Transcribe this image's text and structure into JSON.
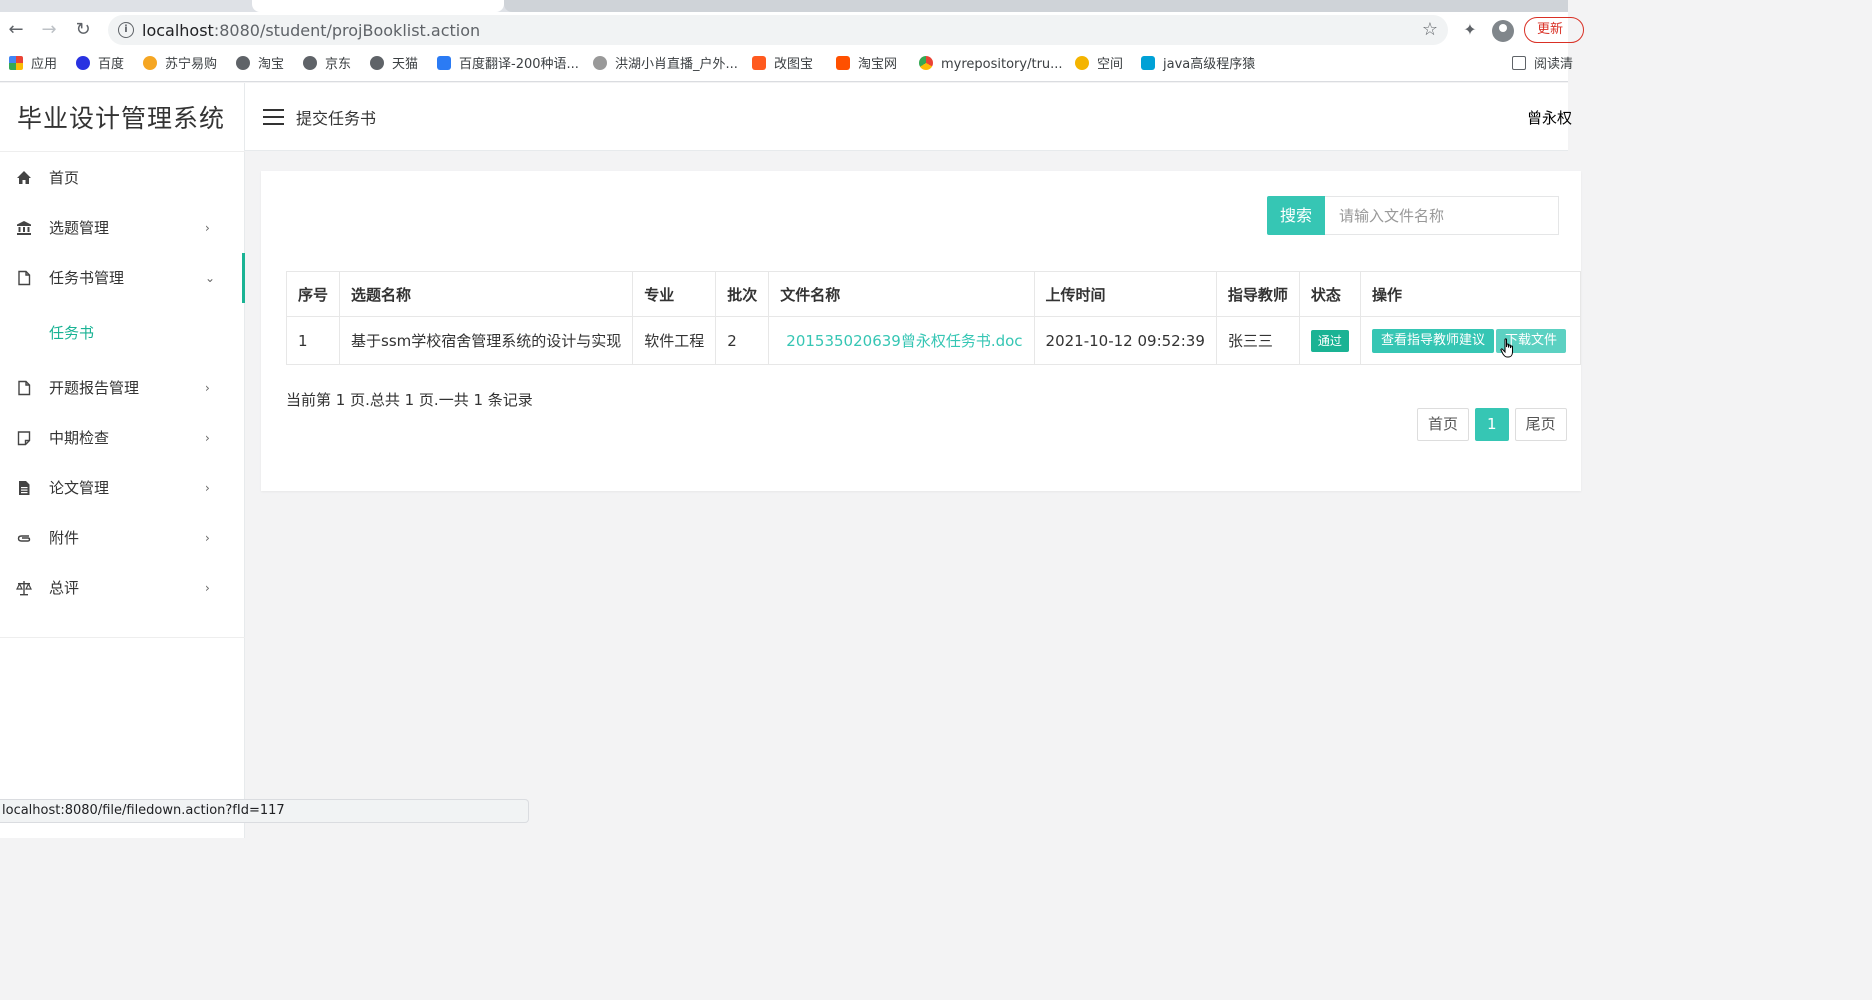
{
  "browser": {
    "url_host": "localhost",
    "url_rest": ":8080/student/projBooklist.action",
    "update_label": "更新",
    "bookmarks": [
      {
        "label": "应用",
        "icon": "apps-grid-icon",
        "color": "#4285f4"
      },
      {
        "label": "百度",
        "icon": "baidu-paw-icon",
        "color": "#2932e1"
      },
      {
        "label": "苏宁易购",
        "icon": "suning-icon",
        "color": "#f5a623"
      },
      {
        "label": "淘宝",
        "icon": "globe-icon",
        "color": "#5f6368"
      },
      {
        "label": "京东",
        "icon": "globe-icon",
        "color": "#5f6368"
      },
      {
        "label": "天猫",
        "icon": "globe-icon",
        "color": "#5f6368"
      },
      {
        "label": "百度翻译-200种语...",
        "icon": "translate-icon",
        "color": "#2b7bf4"
      },
      {
        "label": "洪湖小肖直播_户外...",
        "icon": "bird-icon",
        "color": "#888888"
      },
      {
        "label": "改图宝",
        "icon": "gaitubao-icon",
        "color": "#ff5a1f"
      },
      {
        "label": "淘宝网",
        "icon": "taobao-icon",
        "color": "#ff5000"
      },
      {
        "label": "myrepository/tru...",
        "icon": "chrome-icon",
        "color": "#34a853"
      },
      {
        "label": "空间",
        "icon": "qzone-icon",
        "color": "#f4b400"
      },
      {
        "label": "java高级程序猿",
        "icon": "bilibili-icon",
        "color": "#00a1d6"
      },
      {
        "label": "阅读清",
        "icon": "reading-list-icon",
        "color": "#5f6368"
      }
    ],
    "status_url": "localhost:8080/file/filedown.action?fId=117"
  },
  "app": {
    "logo": "毕业设计管理系统",
    "header_title": "提交任务书",
    "user_name": "曾永权",
    "menu": [
      {
        "label": "首页",
        "icon": "home-icon",
        "arrow": ""
      },
      {
        "label": "选题管理",
        "icon": "bank-icon",
        "arrow": "›"
      },
      {
        "label": "任务书管理",
        "icon": "file-icon",
        "arrow": "⌄"
      },
      {
        "label": "开题报告管理",
        "icon": "file-icon",
        "arrow": "›"
      },
      {
        "label": "中期检查",
        "icon": "note-icon",
        "arrow": "›"
      },
      {
        "label": "论文管理",
        "icon": "document-icon",
        "arrow": "›"
      },
      {
        "label": "附件",
        "icon": "paperclip-icon",
        "arrow": "›"
      },
      {
        "label": "总评",
        "icon": "balance-scale-icon",
        "arrow": "›"
      }
    ],
    "submenu_item": "任务书",
    "search": {
      "button_label": "搜索",
      "placeholder": "请输入文件名称",
      "value": ""
    },
    "table": {
      "columns": [
        "序号",
        "选题名称",
        "专业",
        "批次",
        "文件名称",
        "上传时间",
        "指导教师",
        "状态",
        "操作"
      ],
      "rows": [
        {
          "index": "1",
          "topic": "基于ssm学校宿舍管理系统的设计与实现",
          "major": "软件工程",
          "batch": "2",
          "file_name": "201535020639曾永权任务书.doc",
          "upload_time": "2021-10-12 09:52:39",
          "teacher": "张三三",
          "status": "通过",
          "actions": [
            "查看指导教师建议",
            "下载文件"
          ]
        }
      ]
    },
    "page_info": "当前第 1 页.总共 1 页.一共 1 条记录",
    "pager": {
      "first": "首页",
      "current": "1",
      "last": "尾页"
    },
    "colors": {
      "accent": "#36c6b4",
      "active_menu": "#1ab394"
    }
  }
}
